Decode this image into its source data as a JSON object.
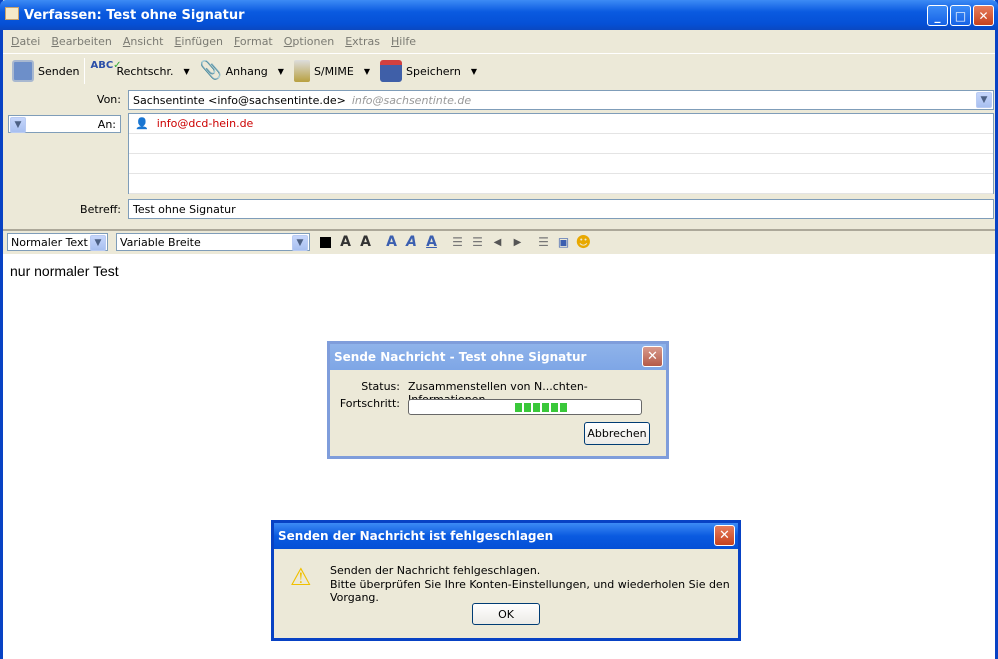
{
  "window": {
    "title": "Verfassen: Test ohne Signatur"
  },
  "menu": [
    "Datei",
    "Bearbeiten",
    "Ansicht",
    "Einfügen",
    "Format",
    "Optionen",
    "Extras",
    "Hilfe"
  ],
  "toolbar": {
    "send": "Senden",
    "spell": "Rechtschr.",
    "attach": "Anhang",
    "smime": "S/MIME",
    "save": "Speichern"
  },
  "header": {
    "from_label": "Von:",
    "from_value": "Sachsentinte <info@sachsentinte.de>",
    "from_hint": "info@sachsentinte.de",
    "to_label": "An:",
    "to_value": "info@dcd-hein.de",
    "subject_label": "Betreff:",
    "subject_value": "Test ohne Signatur"
  },
  "format": {
    "paragraph": "Normaler Text",
    "font": "Variable Breite"
  },
  "body": {
    "text": "nur normaler Test"
  },
  "progress_dialog": {
    "title": "Sende Nachricht - Test ohne Signatur",
    "status_label": "Status:",
    "status_value": "Zusammenstellen von N...chten-Informationen...",
    "progress_label": "Fortschritt:",
    "progress_state": "indeterminate",
    "cancel": "Abbrechen"
  },
  "error_dialog": {
    "title": "Senden der Nachricht ist fehlgeschlagen",
    "line1": "Senden der Nachricht fehlgeschlagen.",
    "line2": "Bitte überprüfen Sie Ihre Konten-Einstellungen, und wiederholen Sie den Vorgang.",
    "ok": "OK"
  }
}
